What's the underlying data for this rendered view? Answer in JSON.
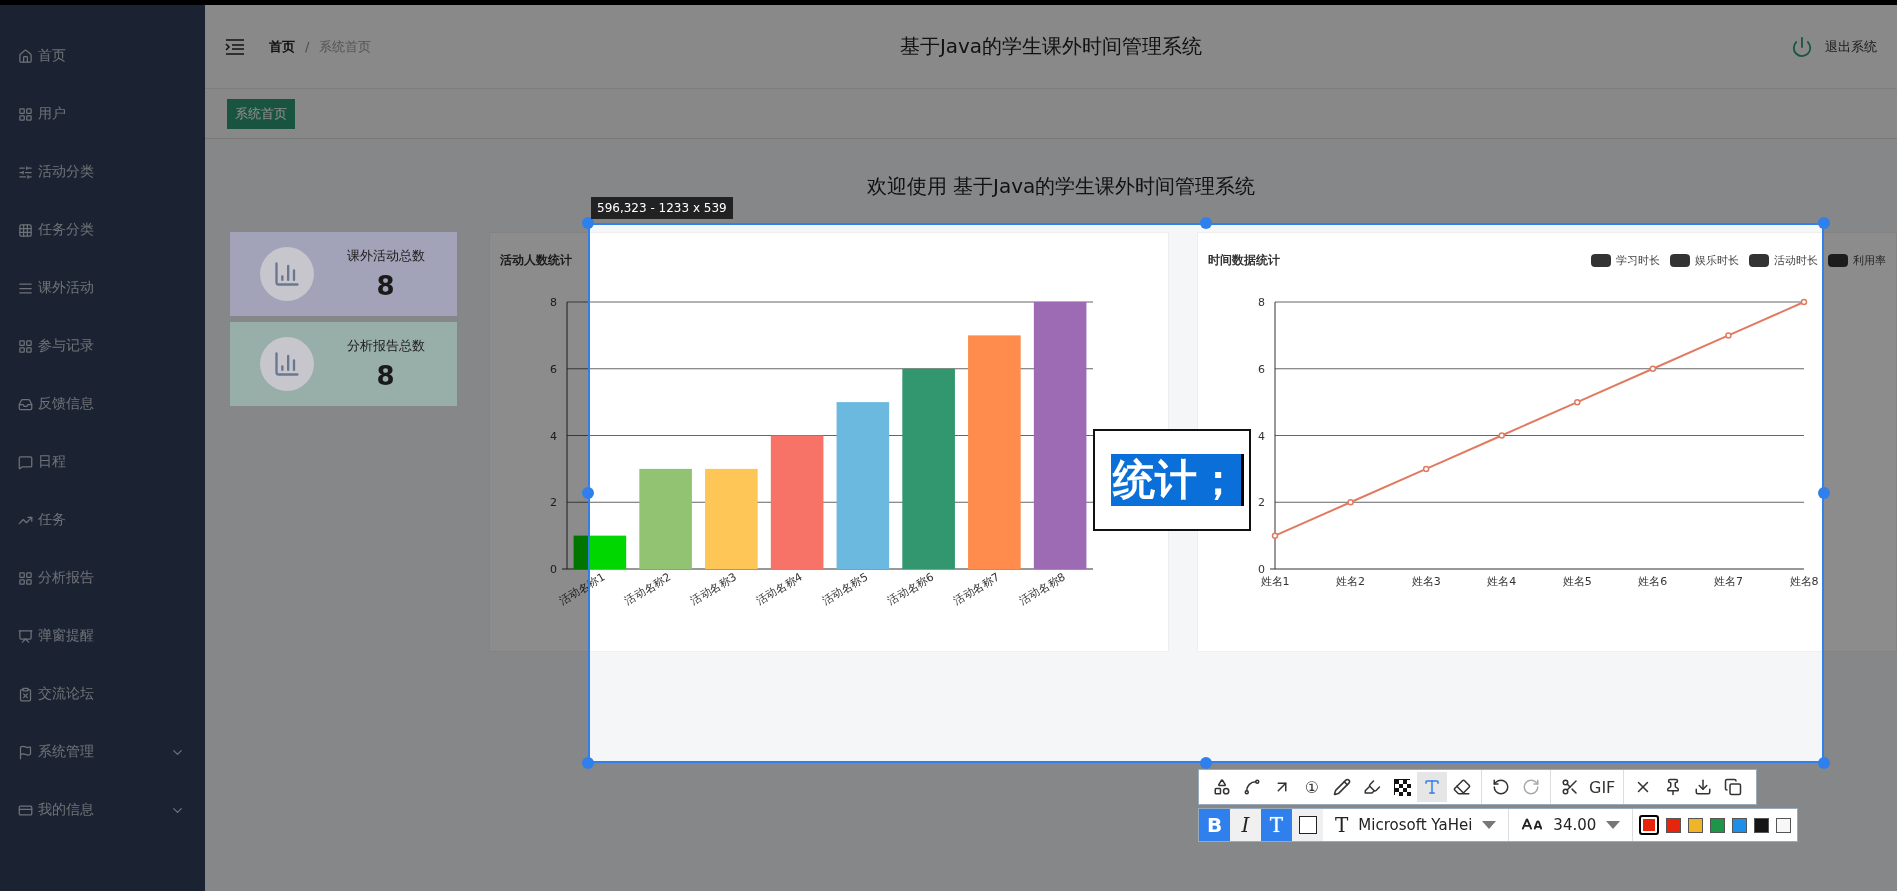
{
  "sidebar": {
    "items": [
      {
        "label": "首页"
      },
      {
        "label": "用户"
      },
      {
        "label": "活动分类"
      },
      {
        "label": "任务分类"
      },
      {
        "label": "课外活动"
      },
      {
        "label": "参与记录"
      },
      {
        "label": "反馈信息"
      },
      {
        "label": "日程"
      },
      {
        "label": "任务"
      },
      {
        "label": "分析报告"
      },
      {
        "label": "弹窗提醒"
      },
      {
        "label": "交流论坛"
      },
      {
        "label": "系统管理",
        "expanded": false
      },
      {
        "label": "我的信息",
        "expanded": false
      }
    ]
  },
  "header": {
    "breadcrumb": [
      "首页",
      "系统首页"
    ],
    "breadcrumb_separator": "/",
    "title": "基于Java的学生课外时间管理系统",
    "logout": "退出系统"
  },
  "tags": [
    {
      "label": "系统首页",
      "selected": true
    }
  ],
  "welcome": "欢迎使用 基于Java的学生课外时间管理系统",
  "stats": [
    {
      "label": "课外活动总数",
      "value": "8",
      "color": "#a2a2b8"
    },
    {
      "label": "分析报告总数",
      "value": "8",
      "color": "#98aea8"
    }
  ],
  "charts": [
    {
      "title": "活动人数统计",
      "chart_data": {
        "type": "bar",
        "categories": [
          "活动名称1",
          "活动名称2",
          "活动名称3",
          "活动名称4",
          "活动名称5",
          "活动名称6",
          "活动名称7",
          "活动名称8"
        ],
        "series": [
          {
            "values": [
              1,
              3,
              3,
              4,
              5,
              6,
              7,
              8
            ]
          }
        ],
        "ylim": [
          0,
          8
        ],
        "yticks": [
          0,
          2,
          4,
          6,
          8
        ],
        "grid": true
      }
    },
    {
      "title": "时间数据统计",
      "legend": [
        "学习时长",
        "娱乐时长",
        "活动时长",
        "利用率"
      ],
      "chart_data": {
        "type": "line",
        "categories": [
          "姓名1",
          "姓名2",
          "姓名3",
          "姓名4",
          "姓名5",
          "姓名6",
          "姓名7",
          "姓名8"
        ],
        "series": [
          {
            "color": "#e07b61",
            "values": [
              1,
              2,
              3,
              4,
              5,
              6,
              7,
              8
            ],
            "marker": "circle"
          }
        ],
        "ylim": [
          0,
          8
        ],
        "yticks": [
          0,
          2,
          4,
          6,
          8
        ],
        "grid": true
      }
    }
  ],
  "capture": {
    "size_label": "596,323 - 1233 x 539",
    "typed_text": "统计；",
    "tools": [
      [
        {
          "selected": false
        },
        {
          "selected": false
        },
        {
          "selected": false
        },
        {
          "label": "①",
          "selected": false
        },
        {
          "selected": false
        },
        {
          "selected": false
        },
        {
          "selected": false
        },
        {
          "selected": true
        },
        {
          "selected": false
        }
      ],
      [
        {
          "selected": false
        },
        {
          "selected": false,
          "disabled": true
        }
      ],
      [
        {
          "selected": false
        },
        {
          "label": "GIF",
          "selected": false
        }
      ],
      [
        {
          "selected": false
        },
        {
          "selected": false
        },
        {
          "selected": false
        },
        {
          "selected": false
        }
      ]
    ],
    "styles": [
      {
        "label": "B",
        "selected": true
      },
      {
        "label": "I",
        "selected": false
      },
      {
        "label": "T",
        "selected": true
      },
      {
        "selected": false
      }
    ],
    "font_icon": "T",
    "font": "Microsoft YaHei",
    "font_size": "34.00",
    "colors": [
      {
        "color": "#e8250c",
        "selected": true
      },
      {
        "color": "#e8250c",
        "selected": false
      },
      {
        "color": "#f0b429",
        "selected": false
      },
      {
        "color": "#1f9548",
        "selected": false
      },
      {
        "color": "#1e8fe8",
        "selected": false
      },
      {
        "color": "#151515",
        "selected": false
      },
      {
        "color": "#f7f7f7",
        "selected": false
      }
    ]
  }
}
